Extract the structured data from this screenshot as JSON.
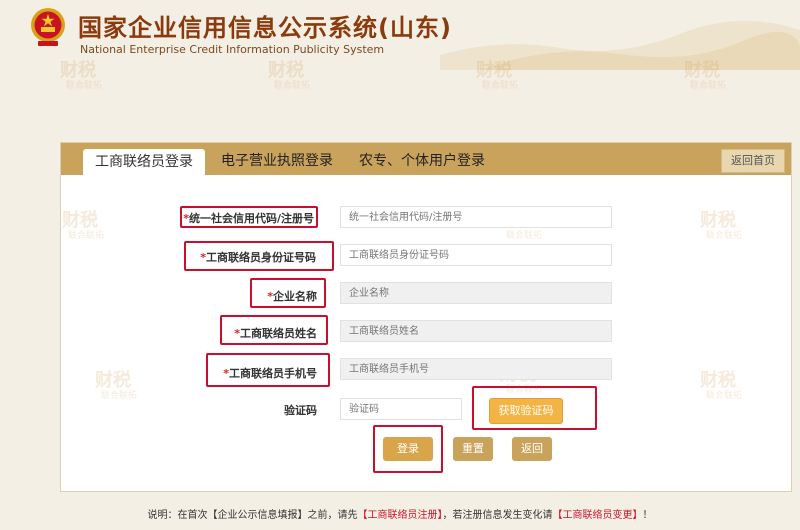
{
  "header": {
    "title": "国家企业信用信息公示系统(山东)",
    "subtitle": "National Enterprise Credit Information Publicity System"
  },
  "watermark": {
    "main": "财税",
    "sub": "联合联拓"
  },
  "tabs": [
    {
      "label": "工商联络员登录",
      "active": true
    },
    {
      "label": "电子营业执照登录",
      "active": false
    },
    {
      "label": "农专、个体用户登录",
      "active": false
    }
  ],
  "home_button": "返回首页",
  "form": {
    "required_mark": "*",
    "fields": [
      {
        "label": "统一社会信用代码/注册号",
        "placeholder": "统一社会信用代码/注册号"
      },
      {
        "label": "工商联络员身份证号码",
        "placeholder": "工商联络员身份证号码"
      },
      {
        "label": "企业名称",
        "placeholder": "企业名称"
      },
      {
        "label": "工商联络员姓名",
        "placeholder": "工商联络员姓名"
      },
      {
        "label": "工商联络员手机号",
        "placeholder": "工商联络员手机号"
      }
    ],
    "captcha": {
      "label": "验证码",
      "placeholder": "验证码"
    },
    "get_code_button": "获取验证码",
    "login_button": "登录",
    "reset_button": "重置",
    "back_button": "返回"
  },
  "footer": {
    "prefix": "说明：在首次【企业公示信息填报】之前，请先",
    "link1": "【工商联络员注册】",
    "middle": "，若注册信息发生变化请",
    "link2": "【工商联络员变更】",
    "suffix": "！"
  },
  "colors": {
    "accent": "#c9a35b",
    "title": "#8a3a0c",
    "highlight_box": "#c8102e",
    "required": "#e02020",
    "code_button": "#f2b445"
  }
}
